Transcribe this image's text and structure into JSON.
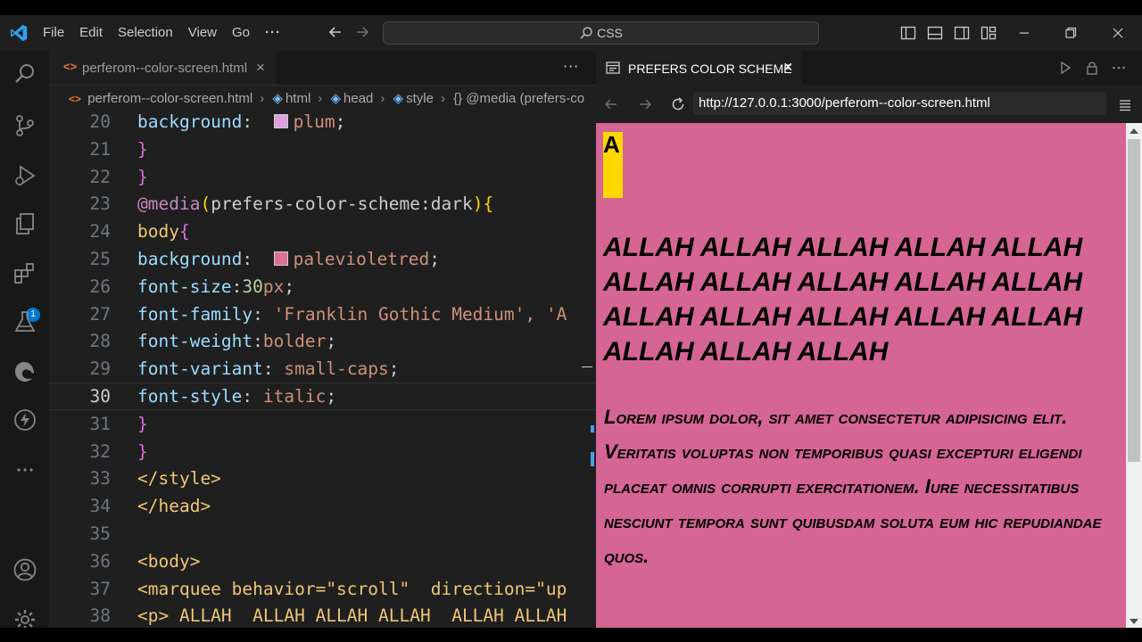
{
  "titlebar": {
    "menu": [
      "File",
      "Edit",
      "Selection",
      "View",
      "Go",
      "···"
    ],
    "command_center": "CSS"
  },
  "activity_bar": {
    "icons": [
      "explorer-icon",
      "search-icon",
      "source-control-icon",
      "run-debug-icon",
      "copy-icon",
      "extensions-icon",
      "testing-icon",
      "edge-icon",
      "thunder-icon",
      "more-icon",
      "account-icon",
      "manage-icon"
    ],
    "extensions_badge": "1"
  },
  "editor": {
    "tab": {
      "label": "perferom--color-screen.html",
      "icon": "<>",
      "close": "×"
    },
    "tab_more": "···",
    "breadcrumb": [
      "perferom--color-screen.html",
      "html",
      "head",
      "style",
      "{} @media (prefers-co"
    ],
    "lines": [
      {
        "n": "20",
        "text": "background:  plum;"
      },
      {
        "n": "21",
        "text": "}"
      },
      {
        "n": "22",
        "text": "}"
      },
      {
        "n": "23",
        "text": "@media(prefers-color-scheme:dark){"
      },
      {
        "n": "24",
        "text": "body{"
      },
      {
        "n": "25",
        "text": "background:  palevioletred;"
      },
      {
        "n": "26",
        "text": "font-size:30px;"
      },
      {
        "n": "27",
        "text": "font-family: 'Franklin Gothic Medium', 'A"
      },
      {
        "n": "28",
        "text": "font-weight:bolder;"
      },
      {
        "n": "29",
        "text": "font-variant: small-caps;"
      },
      {
        "n": "30",
        "text": "font-style: italic;"
      },
      {
        "n": "31",
        "text": "}"
      },
      {
        "n": "32",
        "text": "}"
      },
      {
        "n": "33",
        "text": "</style>"
      },
      {
        "n": "34",
        "text": "</head>"
      },
      {
        "n": "35",
        "text": ""
      },
      {
        "n": "36",
        "text": "<body>"
      },
      {
        "n": "37",
        "text": "<marquee behavior=\"scroll\"  direction=\"up"
      },
      {
        "n": "38",
        "text": "<p> ALLAH  ALLAH ALLAH ALLAH  ALLAH ALLAH"
      }
    ],
    "current_line": "30",
    "colors": {
      "plum": "#dda0dd",
      "palevioletred": "#db7093"
    }
  },
  "preview": {
    "tab_label": "PREFERS COLOR SCHEME",
    "tab_close": "×",
    "url": "http://127.0.0.1:3000/perferom--color-screen.html",
    "page": {
      "marquee_text": "A",
      "allah_text": "ALLAH ALLAH ALLAH ALLAH ALLAH ALLAH ALLAH ALLAH ALLAH ALLAH ALLAH ALLAH ALLAH ALLAH ALLAH ALLAH ALLAH ALLAH",
      "lorem_text": "Lorem ipsum dolor, sit amet consectetur adipisicing elit. Veritatis voluptas non temporibus quasi excepturi eligendi placeat omnis corrupti exercitationem. Iure necessitatibus nesciunt tempora sunt quibusdam soluta eum hic repudiandae quos.",
      "background": "#d56592"
    }
  }
}
